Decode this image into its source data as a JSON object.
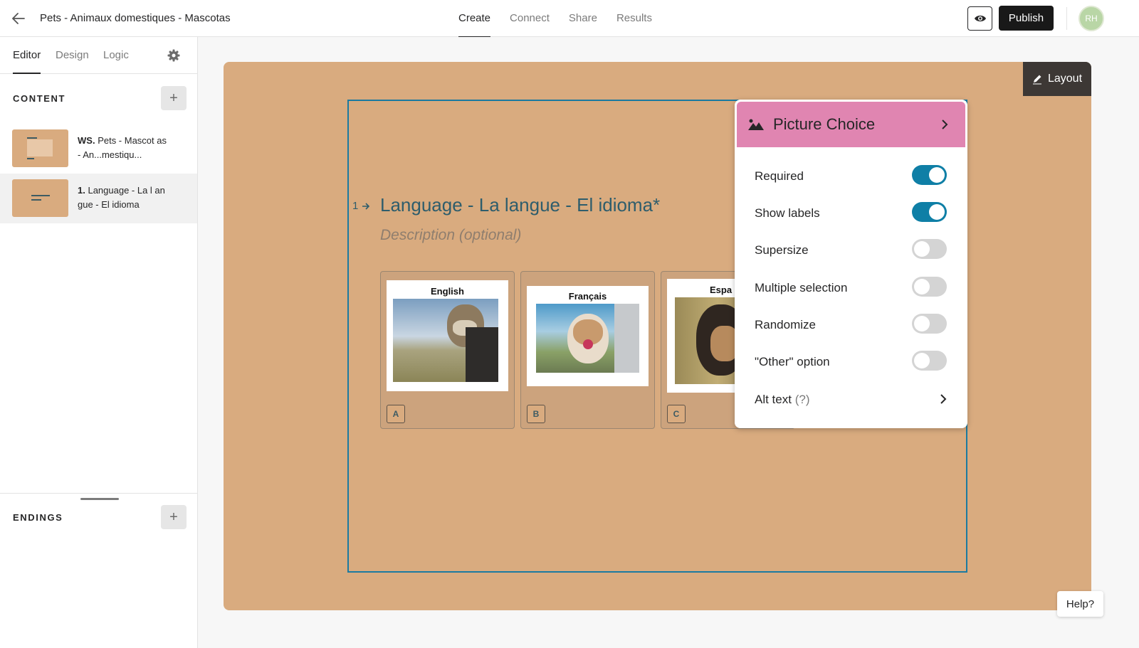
{
  "header": {
    "form_title": "Pets - Animaux domestiques - Mascotas",
    "tabs": [
      "Create",
      "Connect",
      "Share",
      "Results"
    ],
    "active_tab": "Create",
    "publish_label": "Publish",
    "avatar_initials": "RH"
  },
  "sidebar": {
    "tabs": [
      "Editor",
      "Design",
      "Logic"
    ],
    "active_tab": "Editor",
    "content_heading": "CONTENT",
    "endings_heading": "ENDINGS",
    "add_symbol": "+",
    "items": [
      {
        "prefix": "WS.",
        "text": "Pets - Mascot as - An...mestiqu..."
      },
      {
        "prefix": "1.",
        "text": "Language - La l angue - El idioma"
      }
    ]
  },
  "canvas": {
    "layout_label": "Layout",
    "question_number": "1",
    "question_title": "Language - La langue - El idioma*",
    "description_placeholder": "Description (optional)",
    "choices": [
      {
        "caption": "English",
        "key": "A"
      },
      {
        "caption": "Français",
        "key": "B"
      },
      {
        "caption": "Espa",
        "key": "C"
      }
    ]
  },
  "settings_panel": {
    "type_label": "Picture Choice",
    "type_color": "#e085b1",
    "options": [
      {
        "label": "Required",
        "on": true
      },
      {
        "label": "Show labels",
        "on": true
      },
      {
        "label": "Supersize",
        "on": false
      },
      {
        "label": "Multiple selection",
        "on": false
      },
      {
        "label": "Randomize",
        "on": false
      },
      {
        "label": "\"Other\" option",
        "on": false
      }
    ],
    "alt_text_label": "Alt text",
    "alt_text_hint": "(?)"
  },
  "help_label": "Help?",
  "colors": {
    "card_background": "#d9ab7f",
    "accent_blue": "#0f7fa6",
    "question_text": "#2e5d6c"
  }
}
